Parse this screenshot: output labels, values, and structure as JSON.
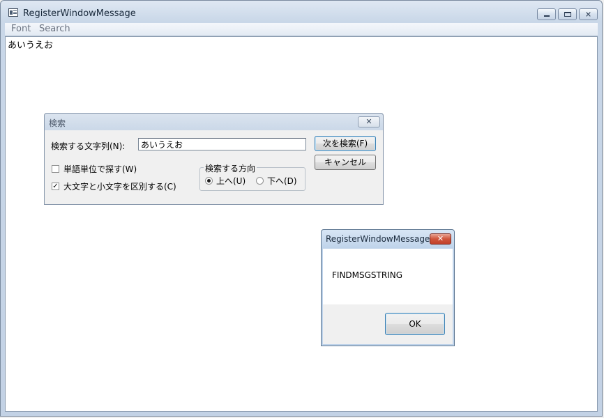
{
  "main_window": {
    "title": "RegisterWindowMessage",
    "menu": [
      "Font",
      "Search"
    ],
    "client_text": "あいうえお"
  },
  "find_dialog": {
    "title": "検索",
    "find_what_label": "検索する文字列(N):",
    "find_what_value": "あいうえお",
    "find_next_label": "次を検索(F)",
    "cancel_label": "キャンセル",
    "whole_word_label": "単語単位で探す(W)",
    "whole_word_checked": false,
    "match_case_label": "大文字と小文字を区別する(C)",
    "match_case_checked": true,
    "direction_label": "検索する方向",
    "up_label": "上へ(U)",
    "down_label": "下へ(D)",
    "direction_selected": "up"
  },
  "message_box": {
    "title": "RegisterWindowMessage",
    "text": "FINDMSGSTRING",
    "ok_label": "OK"
  },
  "icons": [
    "app-icon",
    "minimize-icon",
    "maximize-icon",
    "close-icon",
    "check-icon"
  ],
  "colors": {
    "titlebar": "#c9d7e8",
    "close_button_red": "#d0553c",
    "default_button_border": "#3c7fb1"
  }
}
